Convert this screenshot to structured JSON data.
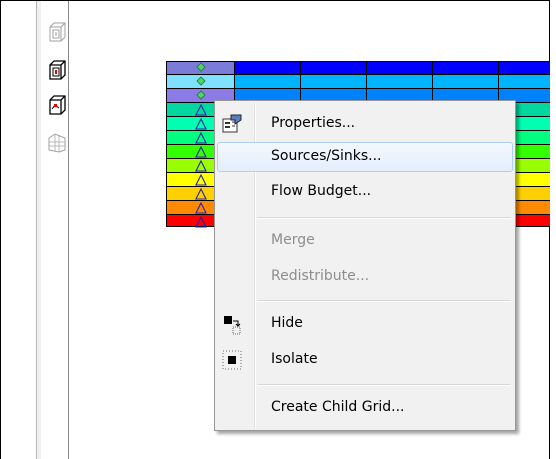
{
  "colors": {
    "row_colors": [
      "#7b7bd8",
      "#0000ff",
      "#7fe0ff",
      "#00b4ff",
      "#8c7be6",
      "#00d8a0",
      "#00ff7f",
      "#33ff00",
      "#99ff00",
      "#ffff00",
      "#ffb000",
      "#ff0000"
    ],
    "menu_hover_border": "#aecff7",
    "disabled_text": "#8d8d8d"
  },
  "toolbar": {
    "buttons": [
      {
        "icon": "layer-1-icon"
      },
      {
        "icon": "layer-grid-icon"
      },
      {
        "icon": "layer-3d-icon"
      },
      {
        "icon": "mesh-view-icon"
      }
    ]
  },
  "context_menu": {
    "items": [
      {
        "id": "properties",
        "label": "Properties...",
        "icon": "properties-icon",
        "enabled": true,
        "hover": false
      },
      {
        "id": "sources-sinks",
        "label": "Sources/Sinks...",
        "icon": null,
        "enabled": true,
        "hover": true
      },
      {
        "id": "flow-budget",
        "label": "Flow Budget...",
        "icon": null,
        "enabled": true,
        "hover": false
      },
      {
        "id": "merge",
        "label": "Merge",
        "icon": null,
        "enabled": false,
        "hover": false
      },
      {
        "id": "redistribute",
        "label": "Redistribute...",
        "icon": null,
        "enabled": false,
        "hover": false
      },
      {
        "id": "hide",
        "label": "Hide",
        "icon": "hide-icon",
        "enabled": true,
        "hover": false
      },
      {
        "id": "isolate",
        "label": "Isolate",
        "icon": "isolate-icon",
        "enabled": true,
        "hover": false
      },
      {
        "id": "create-child-grid",
        "label": "Create Child Grid...",
        "icon": null,
        "enabled": true,
        "hover": false
      }
    ]
  }
}
